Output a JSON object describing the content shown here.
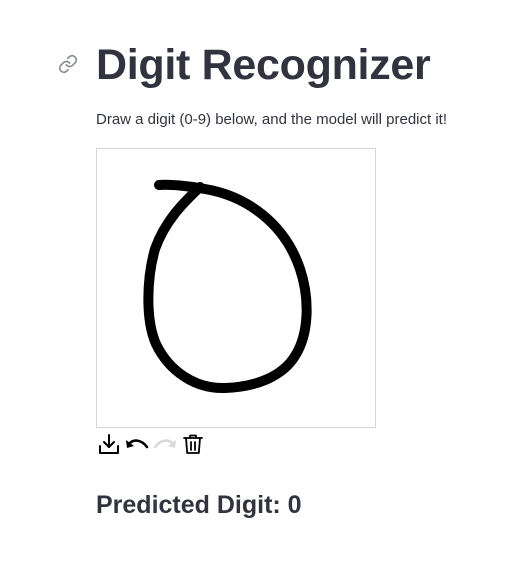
{
  "page": {
    "title": "Digit Recognizer",
    "description": "Draw a digit (0-9) below, and the model will predict it!",
    "anchor_icon": "link-icon"
  },
  "canvas": {
    "stroke_color": "#000000",
    "background_color": "#ffffff"
  },
  "toolbar": {
    "items": [
      {
        "icon": "download-icon",
        "enabled": true
      },
      {
        "icon": "undo-icon",
        "enabled": true
      },
      {
        "icon": "redo-icon",
        "enabled": false
      },
      {
        "icon": "trash-icon",
        "enabled": true
      }
    ]
  },
  "result": {
    "label": "Predicted Digit: 0"
  }
}
